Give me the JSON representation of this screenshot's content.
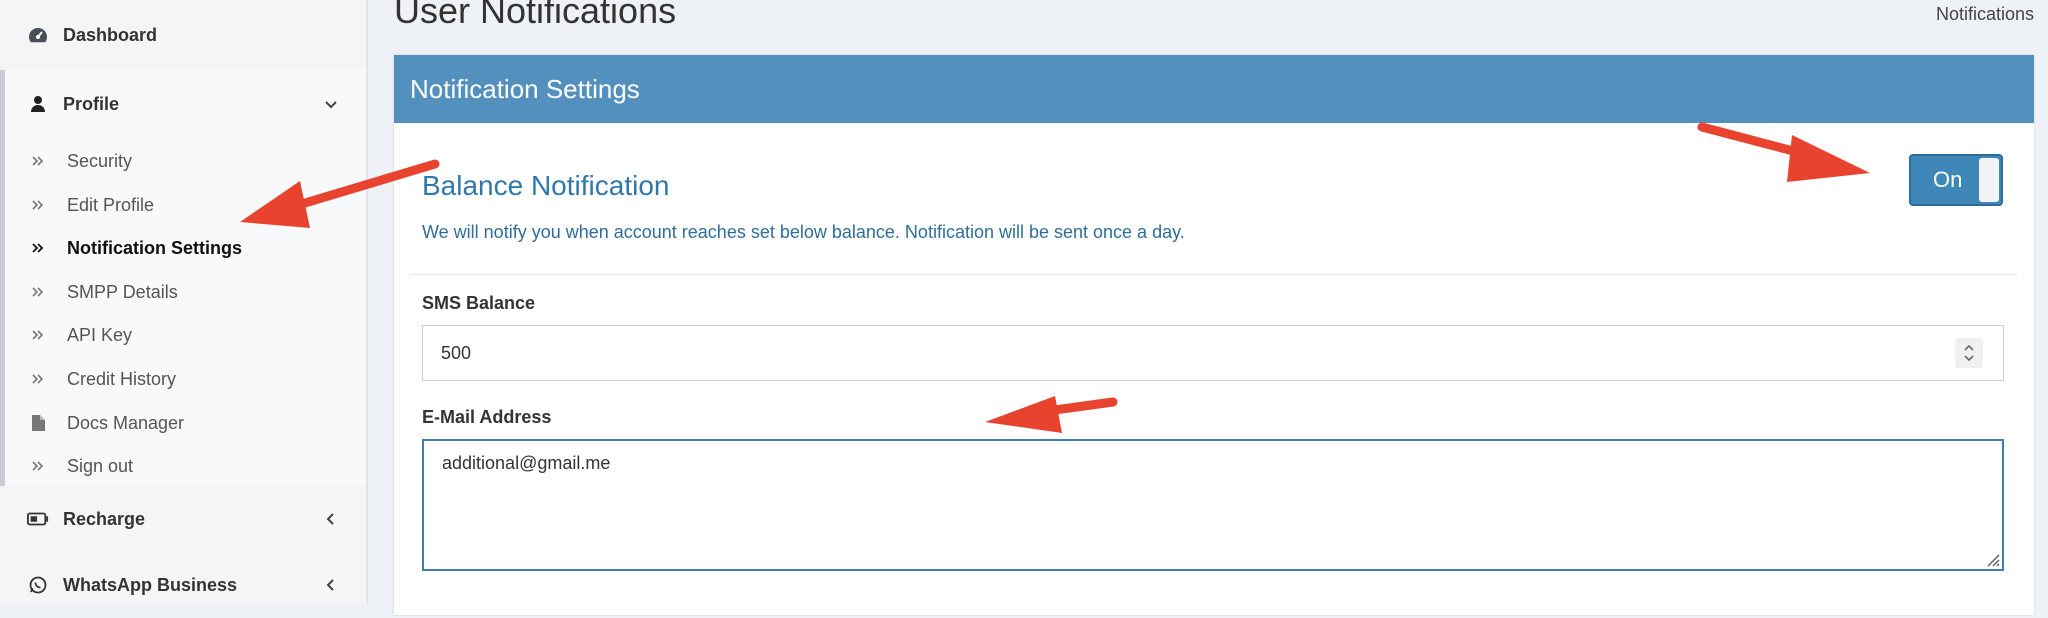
{
  "sidebar": {
    "dashboard": {
      "label": "Dashboard",
      "icon": "dashboard-icon"
    },
    "profile": {
      "label": "Profile",
      "icon": "user-icon"
    },
    "profile_items": [
      {
        "label": "Security",
        "icon": "double-chevron-right-icon"
      },
      {
        "label": "Edit Profile",
        "icon": "double-chevron-right-icon"
      },
      {
        "label": "Notification Settings",
        "icon": "double-chevron-right-icon",
        "active": true
      },
      {
        "label": "SMPP Details",
        "icon": "double-chevron-right-icon"
      },
      {
        "label": "API Key",
        "icon": "double-chevron-right-icon"
      },
      {
        "label": "Credit History",
        "icon": "double-chevron-right-icon"
      },
      {
        "label": "Docs Manager",
        "icon": "file-icon"
      },
      {
        "label": "Sign out",
        "icon": "double-chevron-right-icon"
      }
    ],
    "recharge": {
      "label": "Recharge",
      "icon": "battery-icon"
    },
    "whatsapp": {
      "label": "WhatsApp Business",
      "icon": "whatsapp-icon"
    }
  },
  "page": {
    "title": "User Notifications",
    "breadcrumb": "Notifications"
  },
  "card": {
    "header": "Notification Settings",
    "section_title": "Balance Notification",
    "section_desc": "We will notify you when account reaches set below balance. Notification will be sent once a day.",
    "toggle_label": "On",
    "sms_label": "SMS Balance",
    "sms_value": "500",
    "email_label": "E-Mail Address",
    "email_value": "additional@gmail.me"
  },
  "colors": {
    "header_bg": "#5390bd",
    "accent_text": "#2f78ad",
    "toggle_bg": "#3f87b9",
    "arrow": "#e8432e"
  }
}
